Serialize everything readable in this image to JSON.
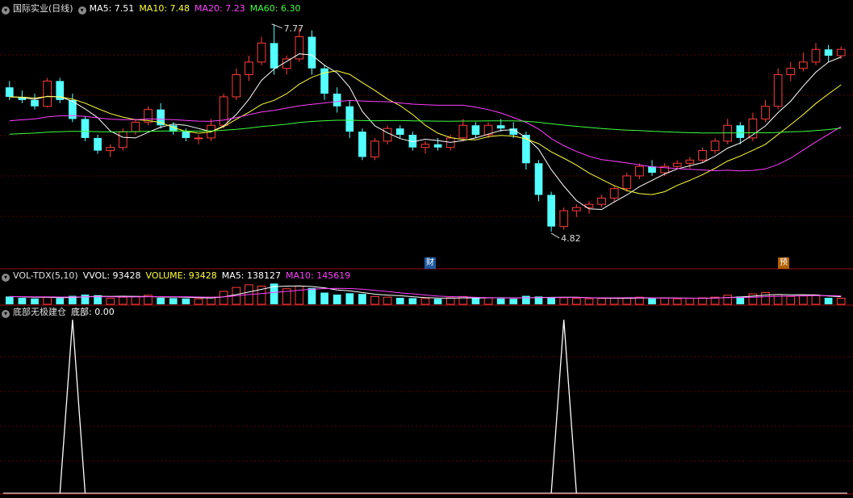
{
  "main_legend": {
    "title": "国际实业(日线)",
    "ma5": "MA5: 7.51",
    "ma10": "MA10: 7.48",
    "ma20": "MA20: 7.23",
    "ma60": "MA60: 6.30"
  },
  "vol_legend": {
    "name": "VOL-TDX(5,10)",
    "vvol": "VVOL: 93428",
    "volume": "VOLUME: 93428",
    "ma5": "MA5: 138127",
    "ma10": "MA10: 145619"
  },
  "ind_legend": {
    "name": "底部无极建仓",
    "value": "底部: 0.00"
  },
  "markers": {
    "cai": "财",
    "yu": "预"
  },
  "chart_data": [
    {
      "type": "candlestick",
      "up_color": "#ff3c3c",
      "down_color": "#54ffff",
      "ma_colors": {
        "ma5": "#ffffff",
        "ma10": "#ffff3c",
        "ma20": "#ff40ff",
        "ma60": "#40ff40"
      },
      "ylim": [
        4.5,
        8.2
      ],
      "annotations": [
        {
          "label": "7.77",
          "type": "high"
        },
        {
          "label": "4.82",
          "type": "low"
        }
      ],
      "ohlc": [
        [
          7.1,
          7.2,
          6.9,
          6.95
        ],
        [
          6.95,
          7.05,
          6.85,
          6.9
        ],
        [
          6.9,
          7.0,
          6.75,
          6.8
        ],
        [
          6.8,
          7.25,
          6.78,
          7.2
        ],
        [
          7.2,
          7.25,
          6.85,
          6.9
        ],
        [
          6.9,
          7.0,
          6.55,
          6.6
        ],
        [
          6.6,
          6.65,
          6.25,
          6.3
        ],
        [
          6.3,
          6.35,
          6.05,
          6.1
        ],
        [
          6.1,
          6.2,
          6.0,
          6.15
        ],
        [
          6.15,
          6.45,
          6.1,
          6.4
        ],
        [
          6.4,
          6.6,
          6.35,
          6.55
        ],
        [
          6.55,
          6.8,
          6.5,
          6.75
        ],
        [
          6.75,
          6.85,
          6.45,
          6.5
        ],
        [
          6.5,
          6.55,
          6.35,
          6.4
        ],
        [
          6.4,
          6.45,
          6.25,
          6.3
        ],
        [
          6.3,
          6.35,
          6.2,
          6.3
        ],
        [
          6.3,
          6.6,
          6.25,
          6.5
        ],
        [
          6.5,
          7.0,
          6.45,
          6.95
        ],
        [
          6.95,
          7.4,
          6.9,
          7.3
        ],
        [
          7.3,
          7.6,
          7.2,
          7.5
        ],
        [
          7.5,
          7.9,
          7.45,
          7.8
        ],
        [
          7.8,
          8.1,
          7.3,
          7.4
        ],
        [
          7.4,
          7.6,
          7.3,
          7.55
        ],
        [
          7.55,
          8.05,
          7.5,
          7.9
        ],
        [
          7.9,
          8.0,
          7.3,
          7.4
        ],
        [
          7.4,
          7.45,
          6.9,
          7.0
        ],
        [
          7.0,
          7.1,
          6.7,
          6.8
        ],
        [
          6.8,
          6.9,
          6.3,
          6.4
        ],
        [
          6.4,
          6.45,
          5.95,
          6.0
        ],
        [
          6.0,
          6.3,
          5.95,
          6.25
        ],
        [
          6.25,
          6.5,
          6.2,
          6.45
        ],
        [
          6.45,
          6.5,
          6.3,
          6.35
        ],
        [
          6.35,
          6.4,
          6.1,
          6.15
        ],
        [
          6.15,
          6.25,
          6.05,
          6.2
        ],
        [
          6.2,
          6.3,
          6.1,
          6.15
        ],
        [
          6.15,
          6.35,
          6.1,
          6.3
        ],
        [
          6.3,
          6.6,
          6.25,
          6.5
        ],
        [
          6.5,
          6.55,
          6.3,
          6.35
        ],
        [
          6.35,
          6.55,
          6.3,
          6.5
        ],
        [
          6.5,
          6.6,
          6.4,
          6.45
        ],
        [
          6.45,
          6.55,
          6.3,
          6.35
        ],
        [
          6.35,
          6.4,
          5.8,
          5.9
        ],
        [
          5.9,
          5.95,
          5.3,
          5.4
        ],
        [
          5.4,
          5.45,
          4.82,
          4.9
        ],
        [
          4.9,
          5.2,
          4.85,
          5.15
        ],
        [
          5.15,
          5.25,
          5.05,
          5.2
        ],
        [
          5.2,
          5.3,
          5.1,
          5.25
        ],
        [
          5.25,
          5.4,
          5.2,
          5.35
        ],
        [
          5.35,
          5.55,
          5.3,
          5.5
        ],
        [
          5.5,
          5.75,
          5.45,
          5.7
        ],
        [
          5.7,
          5.9,
          5.65,
          5.85
        ],
        [
          5.85,
          5.95,
          5.7,
          5.75
        ],
        [
          5.75,
          5.9,
          5.7,
          5.85
        ],
        [
          5.85,
          5.95,
          5.8,
          5.9
        ],
        [
          5.9,
          6.0,
          5.82,
          5.95
        ],
        [
          5.95,
          6.15,
          5.9,
          6.1
        ],
        [
          6.1,
          6.3,
          6.05,
          6.25
        ],
        [
          6.25,
          6.6,
          6.2,
          6.5
        ],
        [
          6.5,
          6.55,
          6.2,
          6.3
        ],
        [
          6.3,
          6.7,
          6.25,
          6.6
        ],
        [
          6.6,
          6.9,
          6.55,
          6.8
        ],
        [
          6.8,
          7.4,
          6.75,
          7.3
        ],
        [
          7.3,
          7.5,
          7.2,
          7.4
        ],
        [
          7.4,
          7.65,
          7.35,
          7.5
        ],
        [
          7.5,
          7.8,
          7.45,
          7.7
        ],
        [
          7.7,
          7.77,
          7.5,
          7.6
        ],
        [
          7.6,
          7.75,
          7.55,
          7.7
        ]
      ],
      "volume": [
        120000,
        100000,
        90000,
        110000,
        95000,
        130000,
        150000,
        140000,
        90000,
        110000,
        120000,
        140000,
        100000,
        95000,
        90000,
        85000,
        110000,
        200000,
        260000,
        300000,
        280000,
        320000,
        240000,
        280000,
        250000,
        180000,
        150000,
        170000,
        160000,
        120000,
        110000,
        100000,
        95000,
        90000,
        85000,
        100000,
        120000,
        95000,
        100000,
        90000,
        85000,
        130000,
        120000,
        110000,
        100000,
        90000,
        85000,
        90000,
        95000,
        100000,
        110000,
        90000,
        95000,
        85000,
        90000,
        100000,
        110000,
        140000,
        120000,
        160000,
        180000,
        150000,
        120000,
        130000,
        140000,
        100000,
        93428
      ],
      "indicator": {
        "name": "底部",
        "signals": [
          5,
          44
        ]
      }
    }
  ]
}
